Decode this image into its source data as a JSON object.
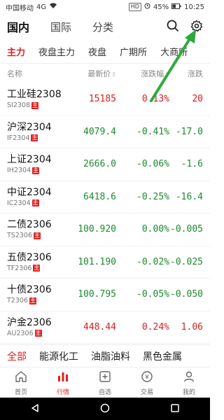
{
  "status_bar": {
    "carrier": "中国移动",
    "signal": "4G",
    "hd_badge": "HD",
    "battery": "45%",
    "time": "10:25"
  },
  "header": {
    "tabs": [
      "国内",
      "国际",
      "分类"
    ],
    "icons": [
      "search-icon",
      "gear-icon"
    ]
  },
  "subtabs": [
    "主力",
    "夜盘主力",
    "夜盘",
    "广期所",
    "大商所"
  ],
  "columns": {
    "name": "名称",
    "price": "最新价",
    "pct": "涨跌幅",
    "change": "涨跌"
  },
  "rows": [
    {
      "name": "工业硅2308",
      "code": "SI2308",
      "tag": "主",
      "price": "15185",
      "pct": "0.13%",
      "change": "20",
      "trend": "up"
    },
    {
      "name": "沪深2304",
      "code": "IF2304",
      "tag": "主",
      "price": "4079.4",
      "pct": "-0.41%",
      "change": "-17.0",
      "trend": "down"
    },
    {
      "name": "上证2304",
      "code": "IH2304",
      "tag": "主",
      "price": "2666.0",
      "pct": "-0.06%",
      "change": "-1.6",
      "trend": "down"
    },
    {
      "name": "中证2304",
      "code": "IC2304",
      "tag": "主",
      "price": "6418.6",
      "pct": "-0.25%",
      "change": "-16.4",
      "trend": "down"
    },
    {
      "name": "二债2306",
      "code": "TS2306",
      "tag": "主",
      "price": "100.920",
      "pct": "0.00%",
      "change": "-0.005",
      "trend": "down"
    },
    {
      "name": "五债2306",
      "code": "TF2306",
      "tag": "主",
      "price": "101.190",
      "pct": "-0.02%",
      "change": "-0.025",
      "trend": "down"
    },
    {
      "name": "十债2306",
      "code": "T2306",
      "tag": "主",
      "price": "100.795",
      "pct": "-0.05%",
      "change": "-0.050",
      "trend": "down"
    },
    {
      "name": "沪金2306",
      "code": "AU2306",
      "tag": "主",
      "price": "448.44",
      "pct": "0.24%",
      "change": "1.06",
      "trend": "up"
    }
  ],
  "category_tabs": [
    "全部",
    "能源化工",
    "油脂油料",
    "黑色金属"
  ],
  "bottom_nav": [
    {
      "label": "首页",
      "icon": "home-icon"
    },
    {
      "label": "行情",
      "icon": "market-icon"
    },
    {
      "label": "自选",
      "icon": "watchlist-icon"
    },
    {
      "label": "交易",
      "icon": "trade-icon"
    },
    {
      "label": "我的",
      "icon": "profile-icon"
    }
  ],
  "colors": {
    "accent": "#e02020",
    "up": "#d81e1e",
    "down": "#1a8a2e",
    "annotation_arrow": "#2eaa3a"
  }
}
